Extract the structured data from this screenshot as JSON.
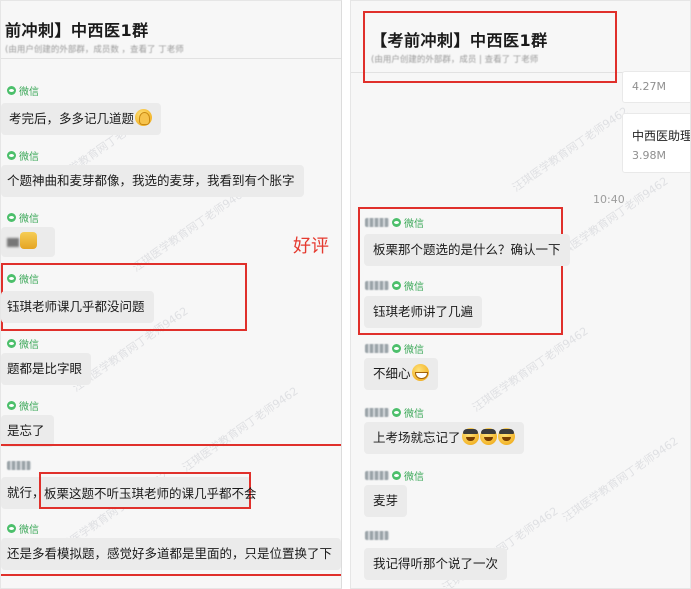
{
  "annotation_text": "好评",
  "watermark_text": "汪琪医学教育网丁老师9462",
  "left": {
    "title": "前冲刺】中西医1群",
    "subtitle": "(由用户创建的外部群，成员数 ，查看了 丁老师",
    "messages": [
      {
        "sender": "微信",
        "text": "考完后，多多记几道题",
        "emoji": "hands"
      },
      {
        "sender": "微信",
        "text": "个题神曲和麦芽都像，我选的麦芽，我看到有个胀字",
        "emoji": ""
      },
      {
        "sender": "微信",
        "text": "",
        "emoji": "thumb"
      },
      {
        "sender": "微信",
        "text": "钰琪老师课几乎都没问题",
        "emoji": ""
      },
      {
        "sender": "微信",
        "text": "题都是比字眼",
        "emoji": ""
      },
      {
        "sender": "微信",
        "text": "是忘了",
        "emoji": ""
      },
      {
        "sender": "",
        "text": "就行，",
        "text2": "板栗这题不听玉琪老师的课几乎都不会",
        "emoji": ""
      },
      {
        "sender": "微信",
        "text": "还是多看模拟题，感觉好多道都是里面的，只是位置换了下",
        "emoji": ""
      }
    ]
  },
  "right": {
    "title": "【考前冲刺】中西医1群",
    "subtitle": "(由用户创建的外部群，成员 | 查看了 丁老师",
    "files": [
      {
        "name": "",
        "size": "4.27M"
      },
      {
        "name": "中西医助理",
        "size": "3.98M"
      }
    ],
    "time": "10:40",
    "messages": [
      {
        "sender": "微信",
        "text": "板栗那个题选的是什么？确认一下",
        "emoji": ""
      },
      {
        "sender": "微信",
        "text": "钰琪老师讲了几遍",
        "emoji": ""
      },
      {
        "sender": "微信",
        "text": "不细心",
        "emoji": "grin"
      },
      {
        "sender": "微信",
        "text": "上考场就忘记了",
        "emoji": "salute3"
      },
      {
        "sender": "微信",
        "text": "麦芽",
        "emoji": ""
      },
      {
        "sender": "",
        "text": "我记得听那个说了一次",
        "emoji": ""
      }
    ]
  },
  "colors": {
    "accent_red": "#e0302b",
    "wechat_green": "#4cbf6b",
    "bubble": "#ebebeb"
  }
}
